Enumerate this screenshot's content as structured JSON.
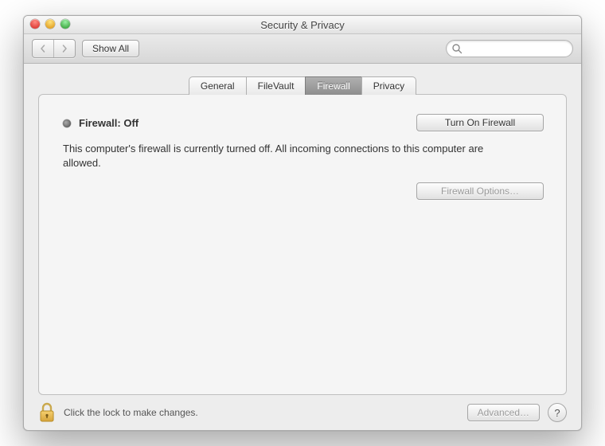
{
  "window": {
    "title": "Security & Privacy"
  },
  "toolbar": {
    "show_all_label": "Show All",
    "search_placeholder": ""
  },
  "tabs": [
    {
      "label": "General",
      "selected": false
    },
    {
      "label": "FileVault",
      "selected": false
    },
    {
      "label": "Firewall",
      "selected": true
    },
    {
      "label": "Privacy",
      "selected": false
    }
  ],
  "firewall": {
    "status_label": "Firewall: Off",
    "status_description": "This computer's firewall is currently turned off. All incoming connections to this computer are allowed.",
    "turn_on_label": "Turn On Firewall",
    "options_label": "Firewall Options…"
  },
  "footer": {
    "lock_text": "Click the lock to make changes.",
    "advanced_label": "Advanced…",
    "help_label": "?"
  }
}
